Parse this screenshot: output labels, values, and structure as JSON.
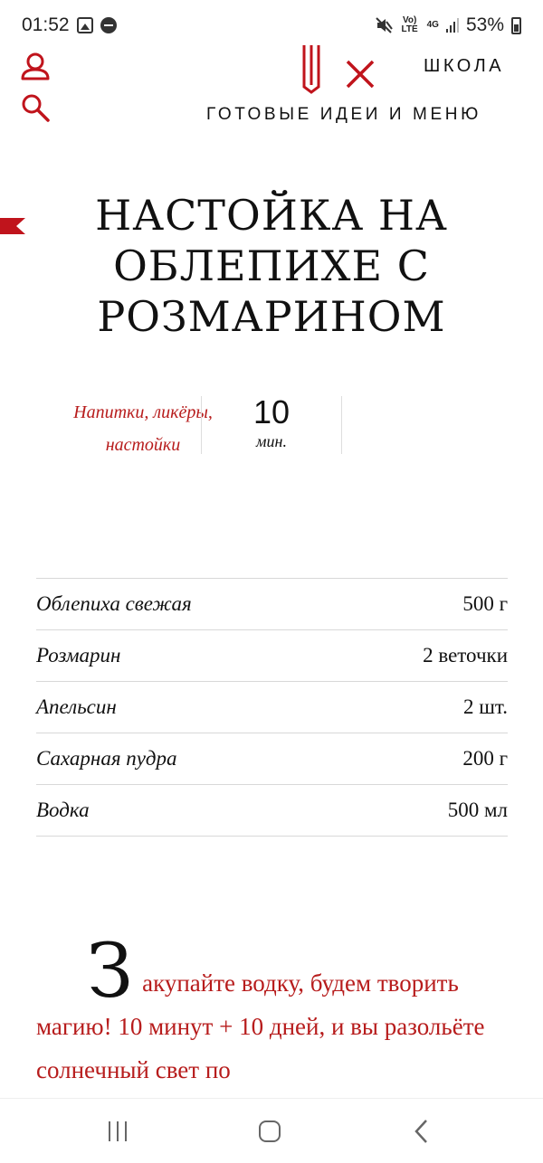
{
  "status_bar": {
    "time": "01:52",
    "network_tag": "Vo) LTE",
    "data_tag": "4G",
    "battery": "53%"
  },
  "header": {
    "school_link": "ШКОЛА",
    "tagline": "ГОТОВЫЕ ИДЕИ И МЕНЮ",
    "accent_color": "#c0141c"
  },
  "recipe": {
    "title": "НАСТОЙКА НА ОБЛЕПИХЕ С РОЗМАРИНОМ",
    "category": "Напитки, ликёры, настойки",
    "time_value": "10",
    "time_unit": "мин."
  },
  "ingredients": [
    {
      "name": "Облепиха свежая",
      "qty": "500 г"
    },
    {
      "name": "Розмарин",
      "qty": "2 веточки"
    },
    {
      "name": "Апельсин",
      "qty": "2 шт."
    },
    {
      "name": "Сахарная пудра",
      "qty": "200 г"
    },
    {
      "name": "Водка",
      "qty": "500 мл"
    }
  ],
  "intro": {
    "dropcap": "З",
    "text": "акупайте водку, будем творить магию! 10 минут + 10 дней, и вы разольёте солнечный свет по"
  }
}
